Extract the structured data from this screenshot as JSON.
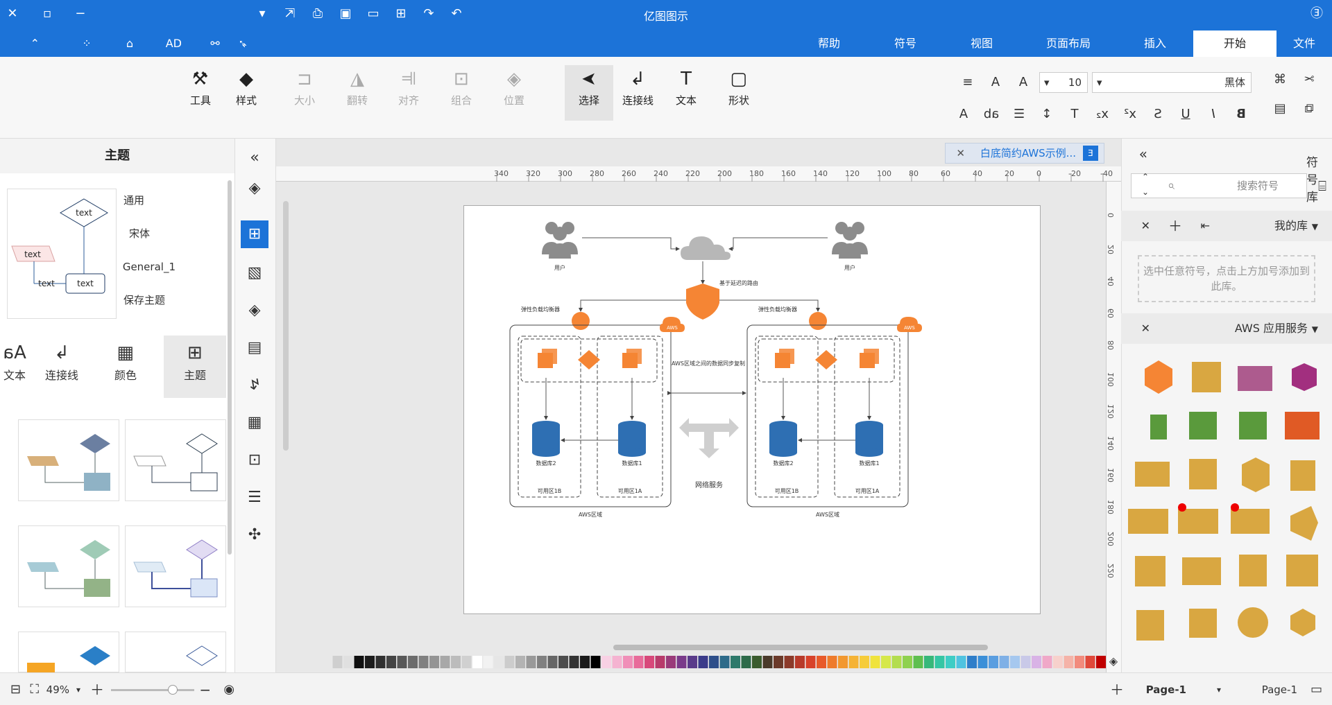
{
  "app": {
    "title": "亿图图示"
  },
  "menu": {
    "tabs": [
      "文件",
      "开始",
      "插入",
      "页面布局",
      "视图",
      "符号",
      "帮助"
    ],
    "active": "开始",
    "ad_label": "AD"
  },
  "ribbon": {
    "font_name": "黑体",
    "font_size": "10",
    "buttons": [
      {
        "label": "形状",
        "icon": "rectangle-icon"
      },
      {
        "label": "文本",
        "icon": "text-icon"
      },
      {
        "label": "连接线",
        "icon": "connector-icon"
      },
      {
        "label": "选择",
        "icon": "pointer-icon"
      },
      {
        "label": "位置",
        "icon": "layers-icon"
      },
      {
        "label": "组合",
        "icon": "group-icon"
      },
      {
        "label": "对齐",
        "icon": "align-icon"
      },
      {
        "label": "翻转",
        "icon": "flip-icon"
      },
      {
        "label": "大小",
        "icon": "size-icon"
      },
      {
        "label": "样式",
        "icon": "style-icon"
      },
      {
        "label": "工具",
        "icon": "tools-icon"
      }
    ]
  },
  "symbol_library": {
    "title": "符号库",
    "search_placeholder": "搜索符号",
    "my_library": "我的库",
    "drop_note": "选中任意符号，点击上方加号添加到此库。",
    "aws_library": "AWS 应用服务"
  },
  "document": {
    "tab_title": "白底简约AWS示例...",
    "ruler_h": [
      "-40",
      "-20",
      "0",
      "20",
      "40",
      "60",
      "80",
      "100",
      "120",
      "140",
      "160",
      "180",
      "200",
      "220",
      "240",
      "260",
      "280",
      "300",
      "320",
      "340"
    ],
    "ruler_v": [
      "0",
      "20",
      "40",
      "60",
      "80",
      "100",
      "120",
      "140",
      "160",
      "180",
      "200",
      "220"
    ]
  },
  "diagram": {
    "user_left": "用户",
    "user_right": "用户",
    "route": "基于延迟的路由",
    "lb_left": "弹性负载均衡器",
    "lb_right": "弹性负载均衡器",
    "sync_note": "AWS区域之间的数据同步复制",
    "db_left_2": "数据库2",
    "db_left_1": "数据库1",
    "db_right_2": "数据库2",
    "db_right_1": "数据库1",
    "zone_b_left": "可用区1B",
    "zone_a_left": "可用区1A",
    "zone_b_right": "可用区1B",
    "zone_a_right": "可用区1A",
    "network": "网络服务",
    "region_left": "AWS区域",
    "region_right": "AWS区域",
    "aws_badge": "AWS"
  },
  "side_tools": [
    "fill-icon",
    "theme-icon",
    "image-icon",
    "layers-icon",
    "page-icon",
    "chart-icon",
    "table-icon",
    "slides-icon",
    "timeline-icon",
    "mindmap-icon"
  ],
  "theme_panel": {
    "title": "主题",
    "items": [
      {
        "label": "通用",
        "icon": "palette-icon"
      },
      {
        "label": "宋体",
        "icon": "font-icon"
      },
      {
        "label": "General_1",
        "icon": "connector-style-icon"
      },
      {
        "label": "保存主题",
        "icon": "save-icon"
      }
    ],
    "categories": [
      "主题",
      "颜色",
      "连接线",
      "文本"
    ],
    "preview_text": "text"
  },
  "statusbar": {
    "page_selector": "Page-1",
    "page_tab": "Page-1",
    "zoom": "49%"
  },
  "colors": {
    "accent": "#1c73d8",
    "aws_orange": "#f58534",
    "db_blue": "#2e6fb3"
  }
}
